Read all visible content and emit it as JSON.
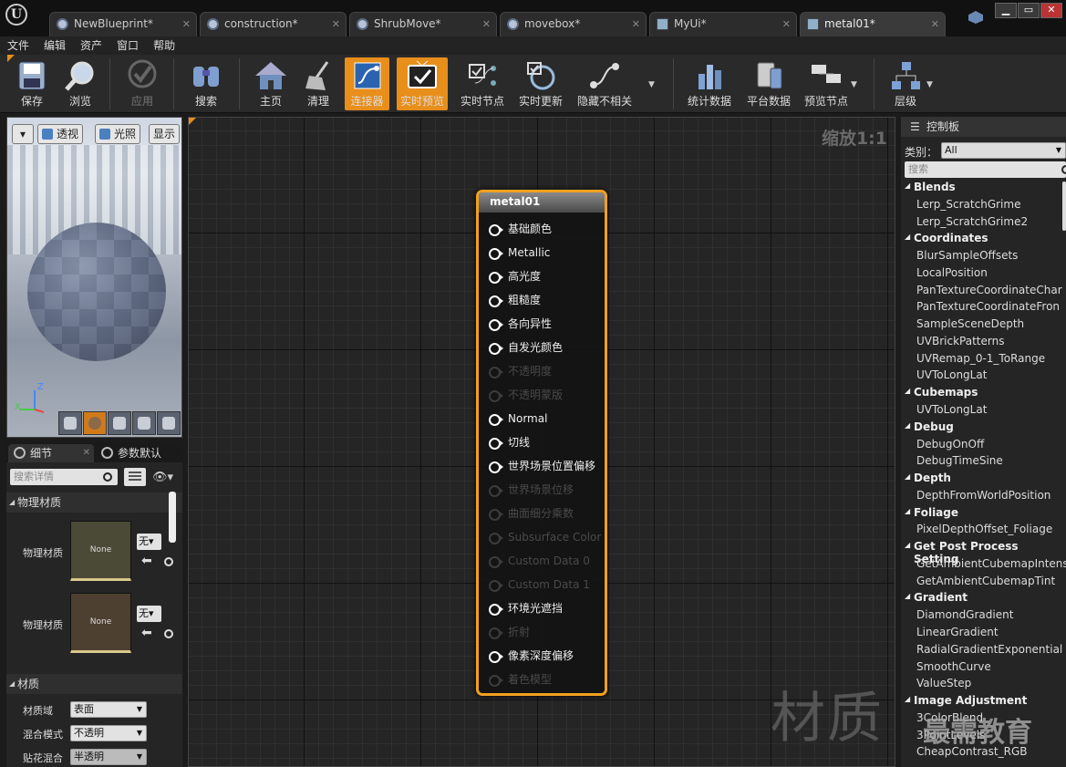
{
  "tabs": [
    {
      "label": "NewBlueprint*",
      "icon": "blueprint-icon"
    },
    {
      "label": "construction*",
      "icon": "blueprint-icon"
    },
    {
      "label": "ShrubMove*",
      "icon": "blueprint-icon"
    },
    {
      "label": "movebox*",
      "icon": "blueprint-icon"
    },
    {
      "label": "MyUi*",
      "icon": "widget-icon"
    },
    {
      "label": "metal01*",
      "icon": "material-icon"
    }
  ],
  "menu": [
    "文件",
    "编辑",
    "资产",
    "窗口",
    "帮助"
  ],
  "toolbar": [
    "保存",
    "浏览",
    "应用",
    "搜索",
    "主页",
    "清理",
    "连接器",
    "实时预览",
    "实时节点",
    "实时更新",
    "隐藏不相关",
    "统计数据",
    "平台数据",
    "预览节点",
    "层级"
  ],
  "viewport": {
    "perspective": "透视",
    "lighting": "光照",
    "show": "显示",
    "axis_z": "Z",
    "axis_x": "X"
  },
  "details": {
    "tab_details": "细节",
    "tab_params": "参数默认",
    "search_placeholder": "搜索详情",
    "section_phys": "物理材质",
    "row1_label": "物理材质",
    "row1_value": "None",
    "row1_btn": "无",
    "row2_label": "物理材质",
    "row2_value": "None",
    "row2_btn": "无",
    "section_mat": "材质",
    "domain_label": "材质域",
    "domain_value": "表面",
    "blend_label": "混合模式",
    "blend_value": "不透明",
    "decal_label": "贴花混合",
    "decal_value": "半透明"
  },
  "graph": {
    "zoom": "缩放1:1",
    "watermark": "材质",
    "node_title": "metal01",
    "pins": [
      {
        "label": "基础颜色",
        "enabled": true
      },
      {
        "label": "Metallic",
        "enabled": true
      },
      {
        "label": "高光度",
        "enabled": true
      },
      {
        "label": "粗糙度",
        "enabled": true
      },
      {
        "label": "各向异性",
        "enabled": true
      },
      {
        "label": "自发光颜色",
        "enabled": true
      },
      {
        "label": "不透明度",
        "enabled": false
      },
      {
        "label": "不透明蒙版",
        "enabled": false
      },
      {
        "label": "Normal",
        "enabled": true
      },
      {
        "label": "切线",
        "enabled": true
      },
      {
        "label": "世界场景位置偏移",
        "enabled": true
      },
      {
        "label": "世界场景位移",
        "enabled": false
      },
      {
        "label": "曲面细分乘数",
        "enabled": false
      },
      {
        "label": "Subsurface Color",
        "enabled": false
      },
      {
        "label": "Custom Data 0",
        "enabled": false
      },
      {
        "label": "Custom Data 1",
        "enabled": false
      },
      {
        "label": "环境光遮挡",
        "enabled": true
      },
      {
        "label": "折射",
        "enabled": false
      },
      {
        "label": "像素深度偏移",
        "enabled": true
      },
      {
        "label": "着色模型",
        "enabled": false
      }
    ]
  },
  "palette": {
    "title": "控制板",
    "category_label": "类别：",
    "category_value": "All",
    "search_placeholder": "搜索",
    "rows": [
      {
        "type": "cat",
        "text": "Blends"
      },
      {
        "type": "item",
        "text": "Lerp_ScratchGrime"
      },
      {
        "type": "item",
        "text": "Lerp_ScratchGrime2"
      },
      {
        "type": "cat",
        "text": "Coordinates"
      },
      {
        "type": "item",
        "text": "BlurSampleOffsets"
      },
      {
        "type": "item",
        "text": "LocalPosition"
      },
      {
        "type": "item",
        "text": "PanTextureCoordinateChar"
      },
      {
        "type": "item",
        "text": "PanTextureCoordinateFron"
      },
      {
        "type": "item",
        "text": "SampleSceneDepth"
      },
      {
        "type": "item",
        "text": "UVBrickPatterns"
      },
      {
        "type": "item",
        "text": "UVRemap_0-1_ToRange"
      },
      {
        "type": "item",
        "text": "UVToLongLat"
      },
      {
        "type": "cat",
        "text": "Cubemaps"
      },
      {
        "type": "item",
        "text": "UVToLongLat"
      },
      {
        "type": "cat",
        "text": "Debug"
      },
      {
        "type": "item",
        "text": "DebugOnOff"
      },
      {
        "type": "item",
        "text": "DebugTimeSine"
      },
      {
        "type": "cat",
        "text": "Depth"
      },
      {
        "type": "item",
        "text": "DepthFromWorldPosition"
      },
      {
        "type": "cat",
        "text": "Foliage"
      },
      {
        "type": "item",
        "text": "PixelDepthOffset_Foliage"
      },
      {
        "type": "cat",
        "text": "Get Post Process Setting"
      },
      {
        "type": "item",
        "text": "GetAmbientCubemapIntens"
      },
      {
        "type": "item",
        "text": "GetAmbientCubemapTint"
      },
      {
        "type": "cat",
        "text": "Gradient"
      },
      {
        "type": "item",
        "text": "DiamondGradient"
      },
      {
        "type": "item",
        "text": "LinearGradient"
      },
      {
        "type": "item",
        "text": "RadialGradientExponential"
      },
      {
        "type": "item",
        "text": "SmoothCurve"
      },
      {
        "type": "item",
        "text": "ValueStep"
      },
      {
        "type": "cat",
        "text": "Image Adjustment"
      },
      {
        "type": "item",
        "text": "3ColorBlend"
      },
      {
        "type": "item",
        "text": "3PointLevels"
      },
      {
        "type": "item",
        "text": "CheapContrast_RGB"
      }
    ],
    "watermark": "最需教育"
  }
}
